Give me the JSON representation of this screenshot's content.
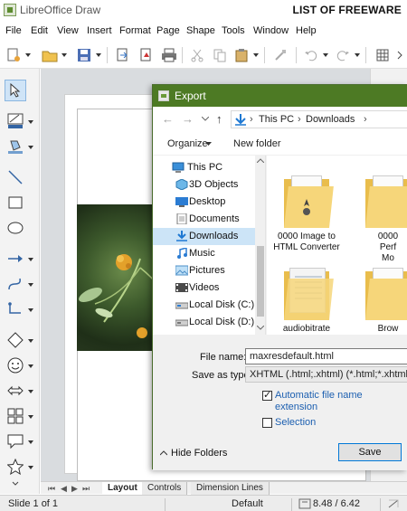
{
  "window": {
    "title": "LibreOffice Draw",
    "brand_text": "LIST OF FREEWARE"
  },
  "menu": [
    "File",
    "Edit",
    "View",
    "Insert",
    "Format",
    "Page",
    "Shape",
    "Tools",
    "Window",
    "Help"
  ],
  "sheet_tabs": {
    "layout": "Layout",
    "controls": "Controls",
    "dimension_lines": "Dimension Lines"
  },
  "status": {
    "slide": "Slide 1 of 1",
    "style": "Default",
    "position": "8.48 / 6.42"
  },
  "dialog": {
    "title": "Export",
    "path": {
      "root": "This PC",
      "folder": "Downloads"
    },
    "commands": {
      "organize": "Organize",
      "new_folder": "New folder"
    },
    "tree": [
      "This PC",
      "3D Objects",
      "Desktop",
      "Documents",
      "Downloads",
      "Music",
      "Pictures",
      "Videos",
      "Local Disk (C:)",
      "Local Disk (D:)"
    ],
    "selected_tree_item": "Downloads",
    "files": {
      "f1": {
        "name_line1": "0000 Image to",
        "name_line2": "HTML Converter"
      },
      "f2": {
        "name_line1": "0000",
        "name_line2": "Perf",
        "name_line3": "Mo"
      },
      "f3": {
        "name": "audiobitrate"
      },
      "f4": {
        "name": "Brow"
      }
    },
    "file_name_label": "File name:",
    "file_name_value": "maxresdefault.html",
    "save_as_type_label": "Save as type:",
    "save_as_type_value": "XHTML (.html;.xhtml) (*.html;*.xhtml)",
    "auto_ext": {
      "label_line1": "Automatic file name",
      "label_line2": "extension",
      "checked": true
    },
    "selection": {
      "label": "Selection",
      "checked": false
    },
    "hide_folders": "Hide Folders",
    "save": "Save"
  },
  "colors": {
    "dialog_title_bg": "#4d7a24",
    "selection_bg": "#cce4f7",
    "link": "#1c5fb0",
    "folder": "#f6d67a"
  }
}
